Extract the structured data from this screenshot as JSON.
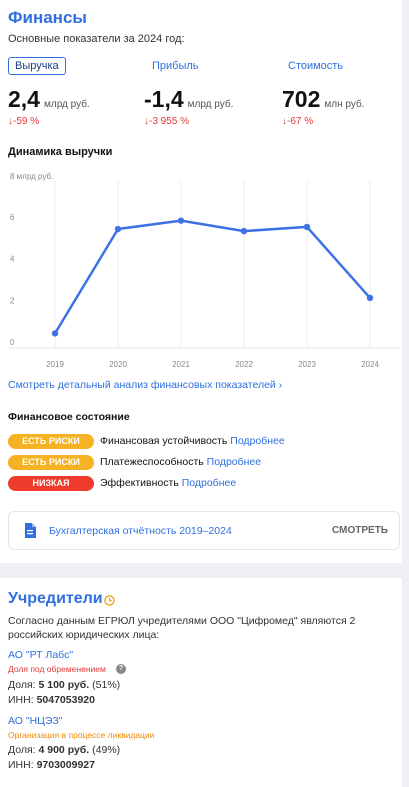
{
  "finances": {
    "title": "Финансы",
    "subtitle": "Основные показатели за 2024 год:",
    "tabs": [
      {
        "label": "Выручка",
        "active": true
      },
      {
        "label": "Прибыль",
        "active": false
      },
      {
        "label": "Стоимость",
        "active": false
      }
    ],
    "kpis": [
      {
        "value": "2,4",
        "unit": "млрд руб.",
        "delta": "↓-59 %"
      },
      {
        "value": "-1,4",
        "unit": "млрд руб.",
        "delta": "↓-3 955 %"
      },
      {
        "value": "702",
        "unit": "млн руб.",
        "delta": "↓-67 %"
      }
    ],
    "chart_title": "Динамика выручки",
    "analysis_link": "Смотреть детальный анализ финансовых показателей ›",
    "state_title": "Финансовое состояние",
    "state_rows": [
      {
        "badge": "ЕСТЬ РИСКИ",
        "label": "Финансовая устойчивость",
        "more": "Подробнее",
        "level": "risk"
      },
      {
        "badge": "ЕСТЬ РИСКИ",
        "label": "Платежеспособность",
        "more": "Подробнее",
        "level": "risk"
      },
      {
        "badge": "НИЗКАЯ",
        "label": "Эффективность",
        "more": "Подробнее",
        "level": "low"
      }
    ],
    "report": {
      "label": "Бухгалтерская отчётность 2019–2024",
      "action": "СМОТРЕТЬ",
      "icon": "document-icon"
    }
  },
  "chart_data": {
    "type": "line",
    "title": "Динамика выручки",
    "unit_label": "8 млрд руб.",
    "x": [
      "2019",
      "2020",
      "2021",
      "2022",
      "2023",
      "2024"
    ],
    "series": [
      {
        "values": [
          0.7,
          5.7,
          6.1,
          5.6,
          5.8,
          2.4
        ]
      }
    ],
    "y_ticks": [
      "0",
      "2",
      "4",
      "6"
    ],
    "ylim": [
      0,
      8
    ],
    "color": "#3d72e6",
    "grid": "vertical"
  },
  "owners": {
    "title": "Учредители",
    "title_icon": "clock-icon",
    "intro_1": "Согласно данным ЕГРЮЛ учредителями ООО \"Цифромед\" являются 2",
    "intro_2": "российских юридических лица:",
    "items": [
      {
        "name": "АО \"РТ Лабс\"",
        "note": "Доля под обременением",
        "note_color": "#e53935",
        "share_label": "Доля:",
        "share_amount": "5 100 руб.",
        "share_pct": "(51%)",
        "inn_label": "ИНН:",
        "inn": "5047053920"
      },
      {
        "name": "АО \"НЦЭЗ\"",
        "note": "Организация в процессе ликвидации",
        "note_color": "#f08a00",
        "share_label": "Доля:",
        "share_amount": "4 900 руб.",
        "share_pct": "(49%)",
        "inn_label": "ИНН:",
        "inn": "9703009927"
      }
    ]
  }
}
